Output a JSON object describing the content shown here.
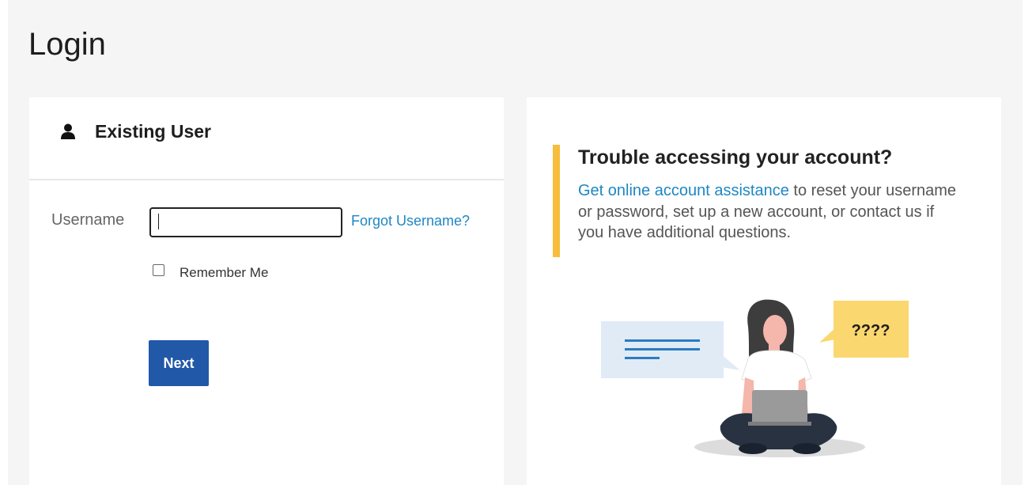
{
  "page": {
    "title": "Login"
  },
  "existing_user": {
    "header": "Existing User",
    "username_label": "Username",
    "username_value": "",
    "forgot_username": "Forgot Username?",
    "remember_me": "Remember Me",
    "remember_checked": false,
    "next_label": "Next"
  },
  "help": {
    "title": "Trouble accessing your account?",
    "link_text": "Get online account assistance",
    "body_text": " to reset your username or password, set up a new account, or contact us if you have additional questions.",
    "speech_bubble_text": "????"
  },
  "colors": {
    "primary_button": "#2158a8",
    "link": "#1e87c2",
    "accent": "#f7bd3c"
  }
}
